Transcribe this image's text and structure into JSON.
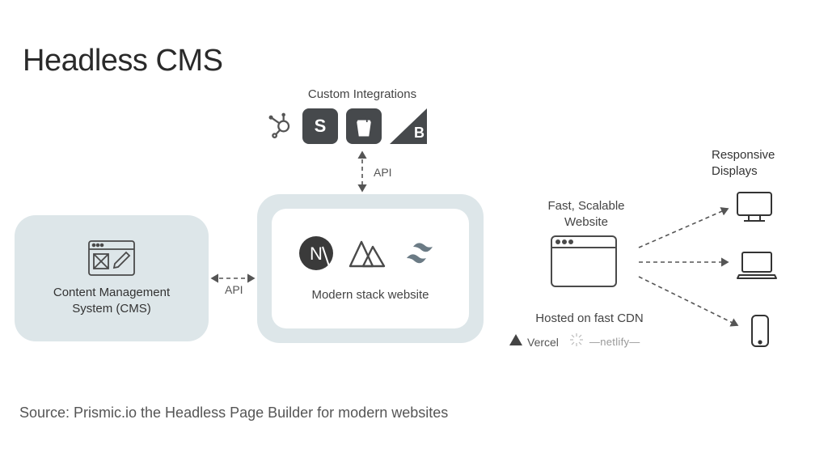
{
  "title": "Headless CMS",
  "integrations": {
    "label": "Custom Integrations",
    "icons": [
      "hubspot",
      "stripe",
      "shopify",
      "bigcommerce"
    ]
  },
  "api_vertical_label": "API",
  "api_horizontal_label": "API",
  "cms": {
    "line1": "Content Management",
    "line2": "System (CMS)"
  },
  "stack": {
    "label": "Modern stack website",
    "icons": [
      "nextjs",
      "nuxt",
      "tailwind"
    ]
  },
  "fast": {
    "line1": "Fast, Scalable",
    "line2": "Website"
  },
  "hosted": {
    "label": "Hosted on fast CDN",
    "vercel": "Vercel",
    "netlify": "netlify"
  },
  "responsive": {
    "line1": "Responsive",
    "line2": "Displays",
    "devices": [
      "desktop",
      "laptop",
      "mobile"
    ]
  },
  "source": "Source: Prismic.io the Headless Page Builder for modern websites"
}
